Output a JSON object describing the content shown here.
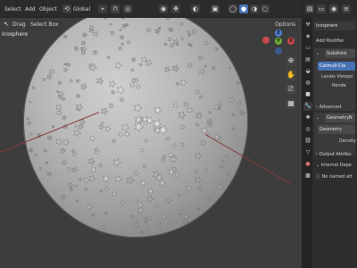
{
  "header": {
    "select_menu": "Select",
    "add_menu": "Add",
    "object_menu": "Object",
    "orientation": "Global",
    "options": "Options"
  },
  "toolbar": {
    "drag_label": "Drag",
    "select_mode": "Select Box"
  },
  "viewport": {
    "object_name": "Icosphere"
  },
  "gizmo": {
    "x": "X",
    "y": "Y",
    "z": "Z"
  },
  "properties": {
    "object_name": "Icosphere",
    "add_modifier": "Add Modifier",
    "modifier_1_name": "Subdivisi",
    "subdiv_type": "Catmull-Cla",
    "levels_viewport": "Levels Viewpo",
    "render": "Rende",
    "advanced": "Advanced",
    "modifier_2_name": "GeometryN",
    "geometry": "Geometry",
    "density": "Density",
    "output_attributes": "Output Attribu",
    "internal_dependencies": "Internal Depe",
    "no_named_attributes": "No named att"
  }
}
